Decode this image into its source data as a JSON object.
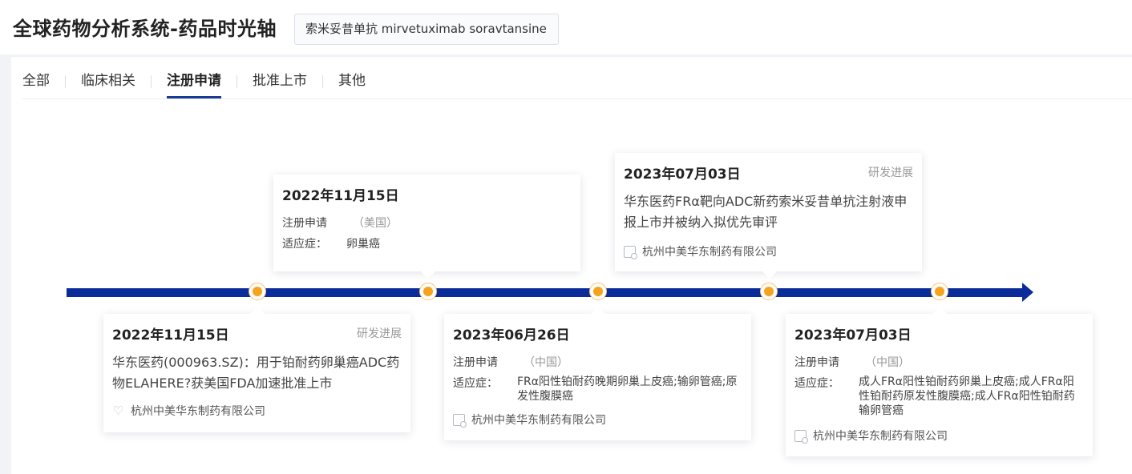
{
  "header": {
    "title": "全球药物分析系统-药品时光轴",
    "drug_tag": "索米妥昔单抗 mirvetuximab soravtansine"
  },
  "tabs": [
    {
      "label": "全部",
      "active": false
    },
    {
      "label": "临床相关",
      "active": false
    },
    {
      "label": "注册申请",
      "active": true
    },
    {
      "label": "批准上市",
      "active": false
    },
    {
      "label": "其他",
      "active": false
    }
  ],
  "colors": {
    "axis": "#0a2b9a",
    "node": "#f7a21b",
    "tab_active": "#1b3a94"
  },
  "events": [
    {
      "date": "2022年11月15日",
      "type_label": "研发进展",
      "text": "华东医药(000963.SZ)：用于铂耐药卵巢癌ADC药物ELAHERE?获美国FDA加速批准上市",
      "company": "杭州中美华东制药有限公司",
      "icon": "heart-icon"
    },
    {
      "date": "2022年11月15日",
      "reg_key": "注册申请",
      "reg_value": "（美国）",
      "ind_key": "适应症：",
      "ind_value": "卵巢癌"
    },
    {
      "date": "2023年06月26日",
      "reg_key": "注册申请",
      "reg_value": "（中国）",
      "ind_key": "适应症：",
      "ind_value": "FRα阳性铂耐药晚期卵巢上皮癌;输卵管癌;原发性腹膜癌",
      "company": "杭州中美华东制药有限公司",
      "icon": "document-icon"
    },
    {
      "date": "2023年07月03日",
      "type_label": "研发进展",
      "text": "华东医药FRα靶向ADC新药索米妥昔单抗注射液申报上市并被纳入拟优先审评",
      "company": "杭州中美华东制药有限公司",
      "icon": "document-icon"
    },
    {
      "date": "2023年07月03日",
      "reg_key": "注册申请",
      "reg_value": "（中国）",
      "ind_key": "适应症：",
      "ind_value": "成人FRα阳性铂耐药卵巢上皮癌;成人FRα阳性铂耐药原发性腹膜癌;成人FRα阳性铂耐药输卵管癌",
      "company": "杭州中美华东制药有限公司",
      "icon": "document-icon"
    }
  ]
}
